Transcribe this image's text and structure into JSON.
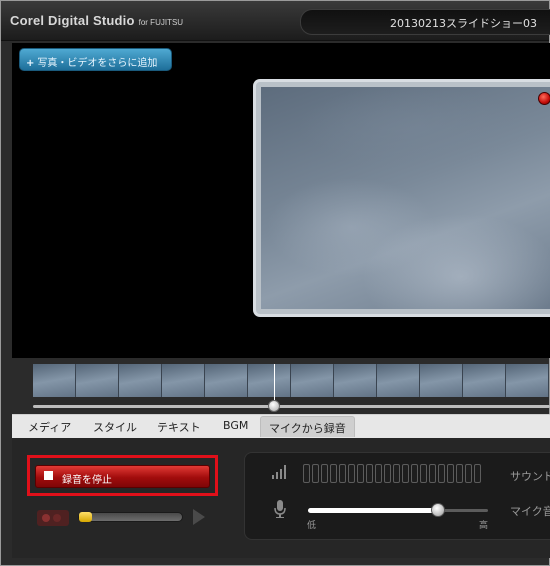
{
  "app": {
    "title": "Corel Digital Studio",
    "title_suffix": "for FUJITSU",
    "project_name": "20130213スライドショー03"
  },
  "preview": {
    "add_button_label": "写真・ビデオをさらに追加",
    "add_button_icon": "plus-icon"
  },
  "tabs": [
    {
      "label": "メディア",
      "active": false
    },
    {
      "label": "スタイル",
      "active": false
    },
    {
      "label": "テキスト",
      "active": false
    },
    {
      "label": "BGM",
      "active": false
    },
    {
      "label": "マイクから録音",
      "active": true
    }
  ],
  "record": {
    "stop_button_label": "録音を停止",
    "stop_button_icon": "stop-icon"
  },
  "mic": {
    "sound_label": "サウンド",
    "mic_volume_label": "マイク音",
    "volume_low_label": "低",
    "volume_high_label": "高",
    "volume_level": 0.72
  },
  "colors": {
    "highlight": "#e0101a",
    "stop_button": "#c11b17",
    "add_button": "#2e86b4",
    "record_indicator": "#d11a12"
  }
}
